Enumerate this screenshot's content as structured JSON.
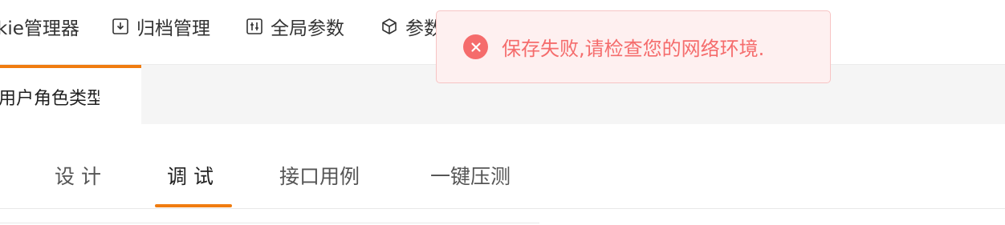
{
  "top_menu": {
    "items": [
      {
        "label": "kie管理器",
        "icon": ""
      },
      {
        "label": "归档管理",
        "icon": "archive-download-icon"
      },
      {
        "label": "全局参数",
        "icon": "sliders-icon"
      },
      {
        "label": "参数",
        "icon": "cube-icon"
      }
    ]
  },
  "doc_tabs": {
    "active_label": "用户角色类型"
  },
  "sub_tabs": {
    "items": [
      {
        "label": "设 计"
      },
      {
        "label": "调 试"
      },
      {
        "label": "接口用例"
      },
      {
        "label": "一键压测"
      }
    ],
    "active_index": 1
  },
  "toast": {
    "type": "error",
    "message": "保存失败,请检查您的网络环境.",
    "icon": "error-circle-icon"
  },
  "colors": {
    "accent": "#f07c10",
    "error": "#f56c6c",
    "error_bg": "#fef0f0"
  }
}
